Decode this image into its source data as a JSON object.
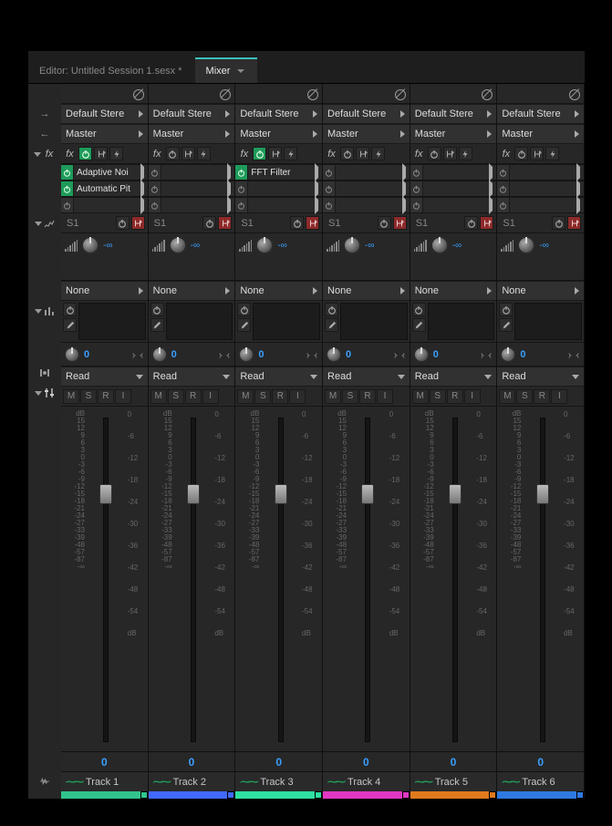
{
  "tabs": {
    "editor": "Editor: Untitled Session 1.sesx *",
    "mixer": "Mixer"
  },
  "left_scale_labels": [
    "dB",
    "15",
    "12",
    "9",
    "6",
    "3",
    "0",
    "-3",
    "-6",
    "-9",
    "-12",
    "-15",
    "-18",
    "-21",
    "-24",
    "-27",
    "-33",
    "-39",
    "-48",
    "-57",
    "-87",
    "-∞"
  ],
  "right_scale_labels": [
    "0",
    "-6",
    "-12",
    "-18",
    "-24",
    "-30",
    "-36",
    "-42",
    "-48",
    "-54",
    "dB"
  ],
  "common": {
    "input_label": "Default Stere",
    "output_label": "Master",
    "fx_label": "fx",
    "none_label": "None",
    "read_label": "Read",
    "pan_value": "0",
    "send_label": "S1",
    "send_value": "-∞",
    "volume": "0",
    "msri": [
      "M",
      "S",
      "R",
      "I"
    ]
  },
  "tracks": [
    {
      "name": "Track 1",
      "color": "#31c48d",
      "color_sq": "#31c48d",
      "fx": [
        {
          "name": "Adaptive Noi",
          "on": true
        },
        {
          "name": "Automatic Pit",
          "on": true
        }
      ],
      "fx_power_on": true
    },
    {
      "name": "Track 2",
      "color": "#4169ff",
      "color_sq": "#4169ff",
      "fx": [],
      "fx_power_on": false
    },
    {
      "name": "Track 3",
      "color": "#2fe0a0",
      "color_sq": "#2fe0a0",
      "fx": [
        {
          "name": "FFT Filter",
          "on": true
        }
      ],
      "fx_power_on": true
    },
    {
      "name": "Track 4",
      "color": "#e038c2",
      "color_sq": "#e038c2",
      "fx": [],
      "fx_power_on": false
    },
    {
      "name": "Track 5",
      "color": "#e07a1e",
      "color_sq": "#e07a1e",
      "fx": [],
      "fx_power_on": false
    },
    {
      "name": "Track 6",
      "color": "#2f79e0",
      "color_sq": "#2f79e0",
      "fx": [],
      "fx_power_on": false
    }
  ]
}
